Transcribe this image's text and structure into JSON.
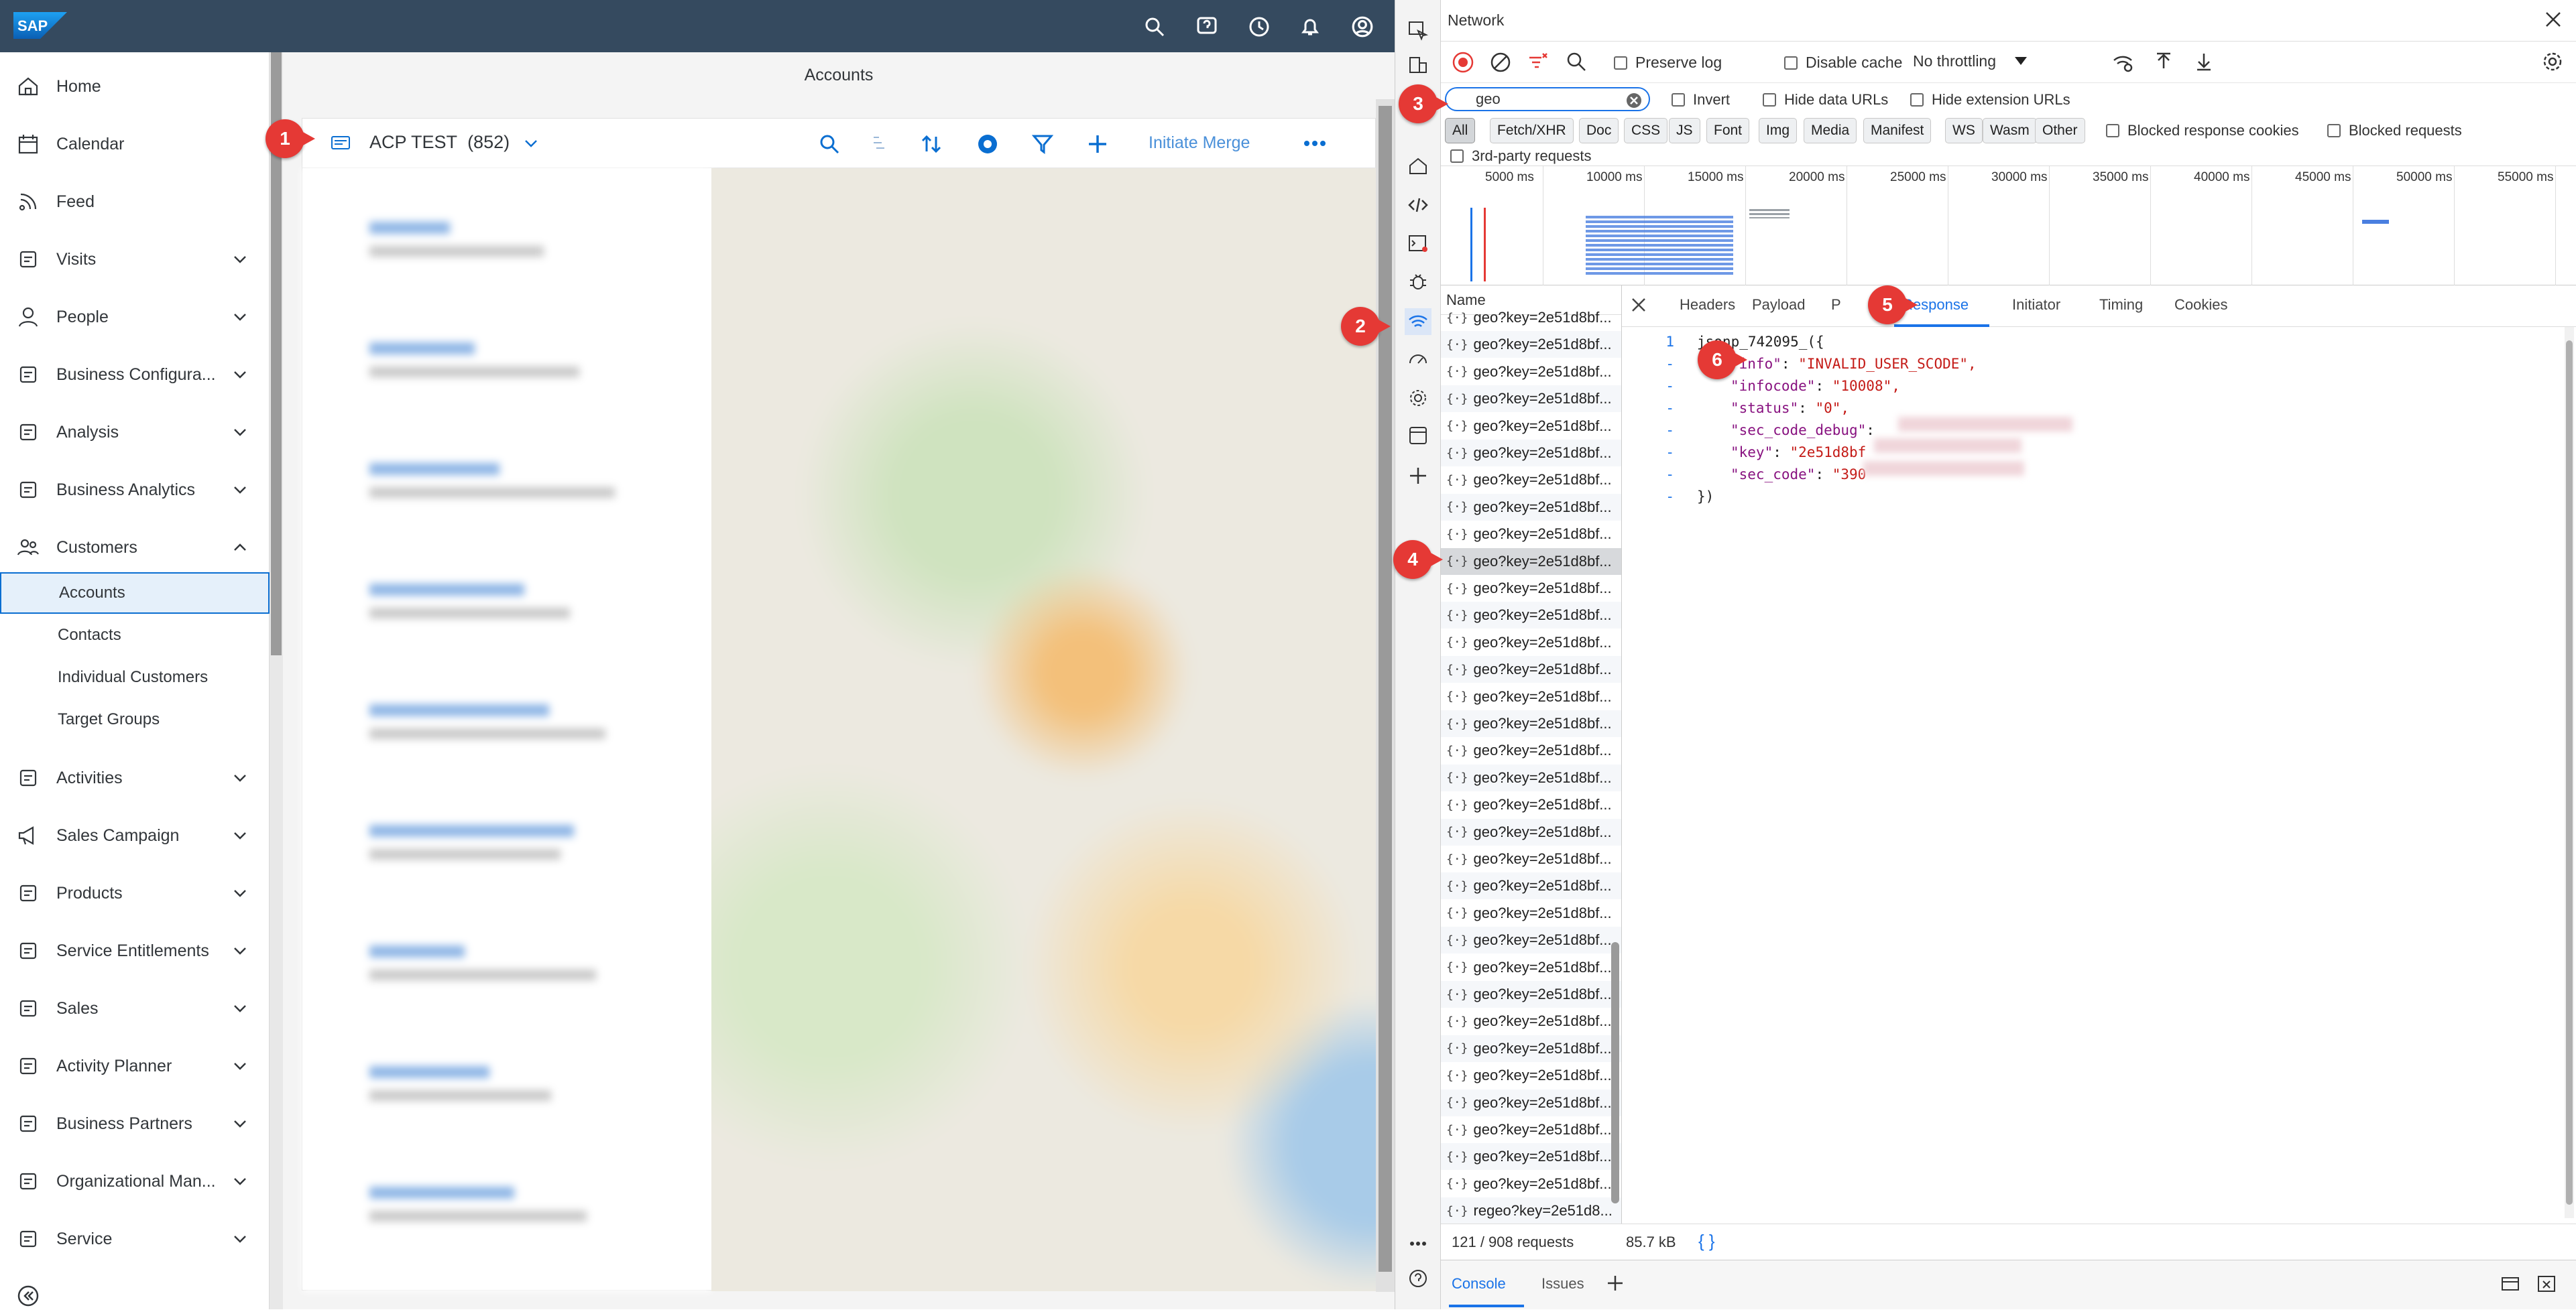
{
  "app": {
    "logo_text": "SAP",
    "page_title": "Accounts",
    "nav": [
      {
        "label": "Home",
        "icon": "home-icon"
      },
      {
        "label": "Calendar",
        "icon": "calendar-icon"
      },
      {
        "label": "Feed",
        "icon": "feed-icon"
      },
      {
        "label": "Visits",
        "icon": "visits-icon",
        "chevron": "down"
      },
      {
        "label": "People",
        "icon": "people-icon",
        "chevron": "down"
      },
      {
        "label": "Business Configura...",
        "icon": "config-icon",
        "chevron": "down"
      },
      {
        "label": "Analysis",
        "icon": "analysis-icon",
        "chevron": "down"
      },
      {
        "label": "Business Analytics",
        "icon": "analytics-icon",
        "chevron": "down"
      },
      {
        "label": "Customers",
        "icon": "customers-icon",
        "chevron": "up"
      }
    ],
    "sub_items": [
      "Accounts",
      "Contacts",
      "Individual Customers",
      "Target Groups"
    ],
    "nav_bottom": [
      {
        "label": "Activities",
        "icon": "activities-icon"
      },
      {
        "label": "Sales Campaign",
        "icon": "megaphone-icon"
      },
      {
        "label": "Products",
        "icon": "products-icon"
      },
      {
        "label": "Service Entitlements",
        "icon": "entitlements-icon"
      },
      {
        "label": "Sales",
        "icon": "sales-icon"
      },
      {
        "label": "Activity Planner",
        "icon": "planner-icon"
      },
      {
        "label": "Business Partners",
        "icon": "partners-icon"
      },
      {
        "label": "Organizational Man...",
        "icon": "org-icon"
      },
      {
        "label": "Service",
        "icon": "service-icon"
      }
    ],
    "toolbar": {
      "view_name": "ACP TEST",
      "count": "(852)",
      "merge_label": "Initiate Merge"
    }
  },
  "badges": [
    "1",
    "2",
    "3",
    "4",
    "5",
    "6"
  ],
  "devtools": {
    "title": "Network",
    "preserve_log": "Preserve log",
    "disable_cache": "Disable cache",
    "throttling": "No throttling",
    "filter_value": "geo",
    "invert": "Invert",
    "hide_data_urls": "Hide data URLs",
    "hide_extension_urls": "Hide extension URLs",
    "types": [
      "All",
      "Fetch/XHR",
      "Doc",
      "CSS",
      "JS",
      "Font",
      "Img",
      "Media",
      "Manifest",
      "WS",
      "Wasm",
      "Other"
    ],
    "blocked_cookies": "Blocked response cookies",
    "blocked_requests": "Blocked requests",
    "third_party": "3rd-party requests",
    "timeline_ticks": [
      "5000 ms",
      "10000 ms",
      "15000 ms",
      "20000 ms",
      "25000 ms",
      "30000 ms",
      "35000 ms",
      "40000 ms",
      "45000 ms",
      "50000 ms",
      "55000 ms"
    ],
    "name_header": "Name",
    "request_name": "geo?key=2e51d8bf...",
    "request_first": "geo?key=2e51d8bf...",
    "request_last": "regeo?key=2e51d8...",
    "tabs": [
      "Headers",
      "Payload",
      "P",
      "Response",
      "Initiator",
      "Timing",
      "Cookies"
    ],
    "code_lines": [
      {
        "ln": "1",
        "text": "jsonp_742095_({"
      },
      {
        "ln": "-",
        "key": "\"info\"",
        "val": "\"INVALID_USER_SCODE\","
      },
      {
        "ln": "-",
        "key": "\"infocode\"",
        "val": "\"10008\","
      },
      {
        "ln": "-",
        "key": "\"status\"",
        "val": "\"0\","
      },
      {
        "ln": "-",
        "key": "\"sec_code_debug\"",
        "val": ""
      },
      {
        "ln": "-",
        "key": "\"key\"",
        "val": "\"2e51d8bf"
      },
      {
        "ln": "-",
        "key": "\"sec_code\"",
        "val": "\"390"
      },
      {
        "ln": "-",
        "text": "})"
      }
    ],
    "status_requests": "121 / 908 requests",
    "status_size": "85.7 kB",
    "braces": "{ }",
    "drawer_tabs": [
      "Console",
      "Issues"
    ]
  }
}
